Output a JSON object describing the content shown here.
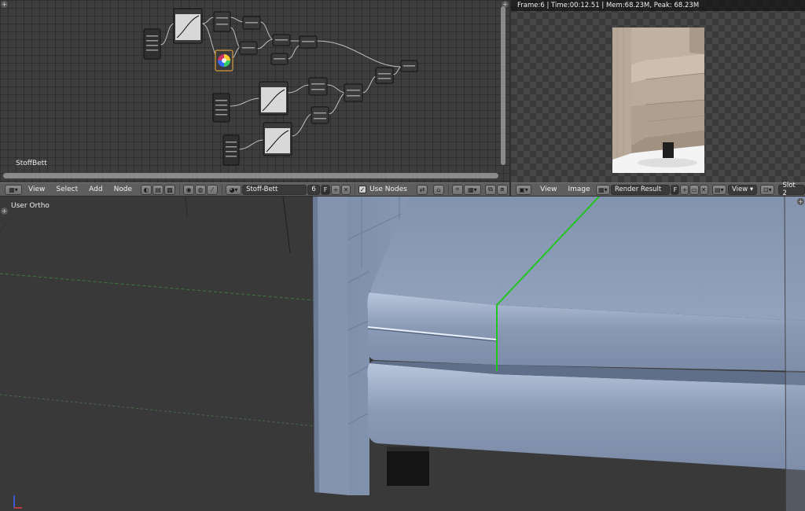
{
  "node_editor": {
    "tree_name": "StoffBett"
  },
  "image_editor": {
    "render_stats": "Frame:6 | Time:00:12.51 | Mem:68.23M, Peak: 68.23M"
  },
  "node_header": {
    "menus": [
      "View",
      "Select",
      "Add",
      "Node"
    ],
    "material_name": "Stoff-Bett",
    "user_count": "6",
    "fake_user": "F",
    "use_nodes_label": "Use Nodes"
  },
  "image_header": {
    "menus": [
      "View",
      "Image"
    ],
    "image_name": "Render Result",
    "fake_user": "F",
    "view_label": "View",
    "slot_label": "Slot 2"
  },
  "viewport": {
    "view_label": "User Ortho"
  },
  "colors": {
    "mesh": "#8b9bb7",
    "selected_edge": "#22c422",
    "header": "#5e5e5e",
    "panel": "#3d3d3d"
  }
}
